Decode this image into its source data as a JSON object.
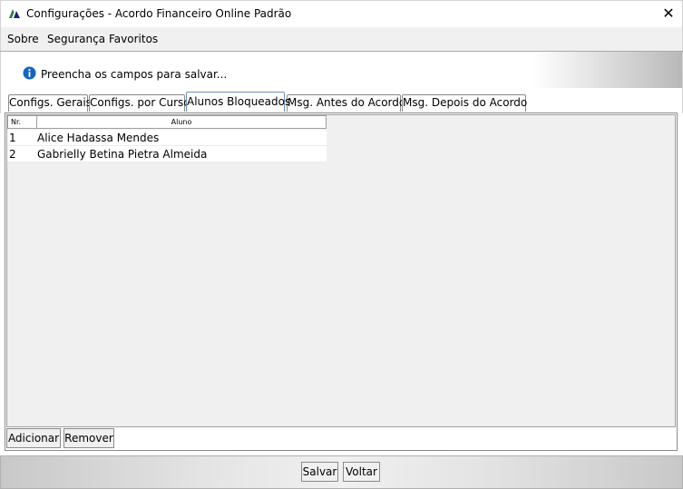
{
  "window": {
    "title": "Configurações - Acordo Financeiro Online Padrão",
    "close_glyph": "✕"
  },
  "menu": {
    "sobre": "Sobre",
    "seguranca": "Segurança",
    "favoritos": "Favoritos"
  },
  "info": {
    "message": "Preencha os campos para salvar..."
  },
  "tabs": {
    "gerais": "Configs. Gerais",
    "curso": "Configs. por Curso",
    "bloqueados": "Alunos Bloqueados",
    "antes": "Msg. Antes do Acordo",
    "depois": "Msg. Depois do Acordo"
  },
  "grid": {
    "col_nr": "Nr.",
    "col_aluno": "Aluno",
    "rows": [
      {
        "nr": "1",
        "aluno": "Alice Hadassa Mendes"
      },
      {
        "nr": "2",
        "aluno": "Gabrielly Betina Pietra Almeida"
      }
    ]
  },
  "buttons": {
    "adicionar": "Adicionar",
    "remover": "Remover",
    "salvar": "Salvar",
    "voltar": "Voltar"
  },
  "colors": {
    "info_icon": "#1565c0",
    "active_tab_border": "#6c8ebf"
  }
}
